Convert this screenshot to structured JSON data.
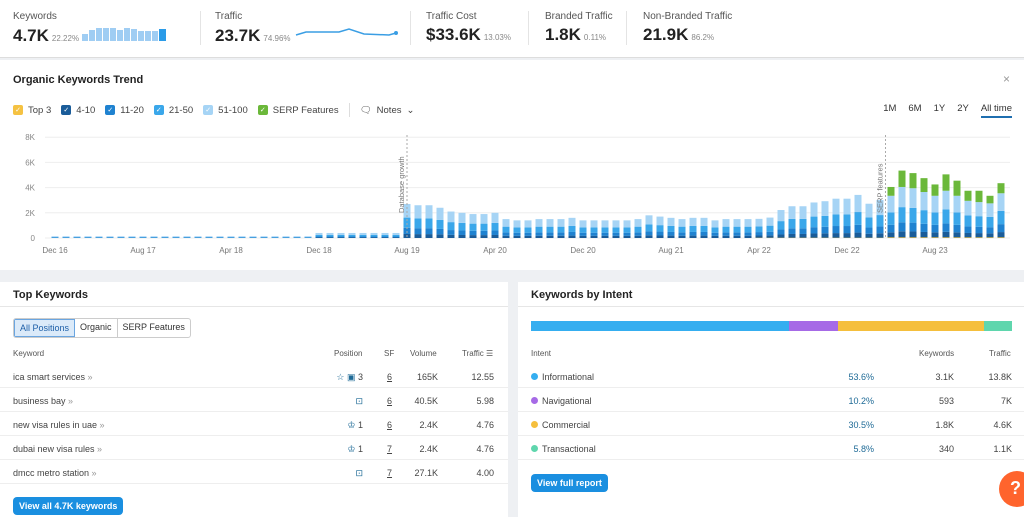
{
  "metrics": [
    {
      "label": "Keywords",
      "value": "4.7K",
      "pct": "22.22%"
    },
    {
      "label": "Traffic",
      "value": "23.7K",
      "pct": "74.96%"
    },
    {
      "label": "Traffic Cost",
      "value": "$33.6K",
      "pct": "13.03%"
    },
    {
      "label": "Branded Traffic",
      "value": "1.8K",
      "pct": "0.11%"
    },
    {
      "label": "Non-Branded Traffic",
      "value": "21.9K",
      "pct": "86.2%"
    }
  ],
  "trend": {
    "title": "Organic Keywords Trend",
    "close_icon": "×",
    "legend": [
      {
        "label": "Top 3",
        "color": "#f5c242"
      },
      {
        "label": "4-10",
        "color": "#1a5c99"
      },
      {
        "label": "11-20",
        "color": "#1f82d0"
      },
      {
        "label": "21-50",
        "color": "#3aa7ea"
      },
      {
        "label": "51-100",
        "color": "#a6d4f5"
      },
      {
        "label": "SERP Features",
        "color": "#6bb83a"
      }
    ],
    "notes_label": "Notes",
    "periods": [
      "1M",
      "6M",
      "1Y",
      "2Y",
      "All time"
    ],
    "active_period": "All time"
  },
  "chart_data": {
    "type": "bar",
    "stacked": true,
    "ylim": [
      0,
      8
    ],
    "y_ticks": [
      {
        "v": 0,
        "label": "0"
      },
      {
        "v": 2,
        "label": "2K"
      },
      {
        "v": 4,
        "label": "4K"
      },
      {
        "v": 6,
        "label": "6K"
      },
      {
        "v": 8,
        "label": "8K"
      }
    ],
    "x_ticks": [
      "Dec 16",
      "Aug 17",
      "Apr 18",
      "Dec 18",
      "Aug 19",
      "Apr 20",
      "Dec 20",
      "Aug 21",
      "Apr 22",
      "Dec 22",
      "Aug 23"
    ],
    "grid": true,
    "annotations": [
      {
        "label": "Database growth",
        "at": "Aug 19"
      },
      {
        "label": "SERP features",
        "at": "Apr 23"
      }
    ],
    "series": [
      {
        "name": "Top 3",
        "color": "#f5c242",
        "values": [
          0,
          0,
          0,
          0,
          0,
          0,
          0,
          0,
          0,
          0,
          0,
          0,
          0,
          0,
          0,
          0,
          0,
          0,
          0,
          0,
          0,
          0,
          0,
          0,
          0,
          0,
          0,
          0,
          0,
          0,
          0,
          0,
          0,
          0,
          0,
          0,
          0,
          0,
          0,
          0,
          0,
          0,
          0,
          0,
          0,
          0,
          0,
          0,
          0,
          0,
          0,
          0,
          0,
          0,
          0,
          0,
          0,
          0,
          0,
          0,
          0,
          0,
          0,
          0,
          0.02,
          0.02,
          0.02,
          0.02,
          0.02,
          0.02,
          0.02,
          0.02,
          0.02,
          0.02,
          0.02,
          0.02,
          0.05,
          0.05,
          0.05,
          0.05,
          0.05,
          0.05,
          0.05,
          0.05,
          0.05,
          0.05,
          0.05
        ]
      },
      {
        "name": "4-10",
        "color": "#1a5c99",
        "values": [
          0.01,
          0.01,
          0.01,
          0.01,
          0.01,
          0.01,
          0.01,
          0.01,
          0.01,
          0.01,
          0.01,
          0.01,
          0.01,
          0.01,
          0.01,
          0.01,
          0.01,
          0.01,
          0.01,
          0.01,
          0.01,
          0.01,
          0.01,
          0.01,
          0.05,
          0.05,
          0.05,
          0.05,
          0.05,
          0.05,
          0.05,
          0.05,
          0.32,
          0.31,
          0.31,
          0.29,
          0.25,
          0.24,
          0.23,
          0.23,
          0.24,
          0.18,
          0.17,
          0.17,
          0.18,
          0.18,
          0.18,
          0.19,
          0.17,
          0.17,
          0.17,
          0.17,
          0.17,
          0.18,
          0.22,
          0.2,
          0.19,
          0.18,
          0.19,
          0.19,
          0.17,
          0.18,
          0.18,
          0.18,
          0.18,
          0.19,
          0.26,
          0.3,
          0.3,
          0.34,
          0.35,
          0.37,
          0.37,
          0.41,
          0.32,
          0.36,
          0.4,
          0.48,
          0.47,
          0.43,
          0.4,
          0.44,
          0.4,
          0.35,
          0.34,
          0.32,
          0.42
        ]
      },
      {
        "name": "11-20",
        "color": "#1f82d0",
        "values": [
          0.02,
          0.02,
          0.02,
          0.02,
          0.02,
          0.02,
          0.02,
          0.02,
          0.02,
          0.02,
          0.02,
          0.02,
          0.02,
          0.02,
          0.02,
          0.02,
          0.02,
          0.02,
          0.02,
          0.02,
          0.02,
          0.02,
          0.02,
          0.02,
          0.07,
          0.07,
          0.07,
          0.07,
          0.07,
          0.07,
          0.07,
          0.07,
          0.49,
          0.47,
          0.47,
          0.43,
          0.38,
          0.36,
          0.34,
          0.34,
          0.36,
          0.27,
          0.25,
          0.25,
          0.27,
          0.27,
          0.27,
          0.29,
          0.25,
          0.25,
          0.25,
          0.25,
          0.25,
          0.27,
          0.32,
          0.31,
          0.29,
          0.27,
          0.29,
          0.29,
          0.25,
          0.27,
          0.27,
          0.27,
          0.27,
          0.29,
          0.4,
          0.45,
          0.45,
          0.5,
          0.52,
          0.56,
          0.56,
          0.61,
          0.49,
          0.54,
          0.59,
          0.72,
          0.7,
          0.65,
          0.59,
          0.67,
          0.59,
          0.52,
          0.5,
          0.49,
          0.63
        ]
      },
      {
        "name": "21-50",
        "color": "#3aa7ea",
        "values": [
          0.03,
          0.03,
          0.03,
          0.03,
          0.03,
          0.03,
          0.03,
          0.03,
          0.03,
          0.03,
          0.03,
          0.03,
          0.03,
          0.03,
          0.03,
          0.03,
          0.03,
          0.03,
          0.03,
          0.03,
          0.03,
          0.03,
          0.03,
          0.03,
          0.12,
          0.12,
          0.12,
          0.12,
          0.12,
          0.12,
          0.12,
          0.12,
          0.81,
          0.78,
          0.78,
          0.72,
          0.63,
          0.6,
          0.57,
          0.57,
          0.6,
          0.45,
          0.42,
          0.42,
          0.45,
          0.45,
          0.45,
          0.48,
          0.42,
          0.42,
          0.42,
          0.42,
          0.42,
          0.45,
          0.54,
          0.51,
          0.48,
          0.45,
          0.48,
          0.48,
          0.42,
          0.45,
          0.45,
          0.45,
          0.45,
          0.48,
          0.66,
          0.75,
          0.75,
          0.84,
          0.87,
          0.93,
          0.93,
          1.02,
          0.81,
          0.9,
          0.99,
          1.2,
          1.17,
          1.08,
          0.99,
          1.11,
          0.99,
          0.87,
          0.84,
          0.81,
          1.05
        ]
      },
      {
        "name": "51-100",
        "color": "#a6d4f5",
        "values": [
          0.04,
          0.04,
          0.04,
          0.04,
          0.04,
          0.04,
          0.04,
          0.04,
          0.04,
          0.04,
          0.04,
          0.04,
          0.04,
          0.04,
          0.04,
          0.04,
          0.04,
          0.04,
          0.04,
          0.04,
          0.04,
          0.04,
          0.04,
          0.04,
          0.16,
          0.16,
          0.16,
          0.16,
          0.16,
          0.16,
          0.16,
          0.16,
          1.08,
          1.04,
          1.04,
          0.96,
          0.84,
          0.8,
          0.76,
          0.76,
          0.8,
          0.6,
          0.56,
          0.56,
          0.6,
          0.6,
          0.6,
          0.64,
          0.56,
          0.56,
          0.56,
          0.56,
          0.56,
          0.6,
          0.72,
          0.68,
          0.64,
          0.6,
          0.64,
          0.64,
          0.56,
          0.6,
          0.6,
          0.6,
          0.6,
          0.64,
          0.88,
          1.0,
          1.0,
          1.12,
          1.16,
          1.24,
          1.24,
          1.36,
          1.08,
          1.2,
          1.32,
          1.6,
          1.56,
          1.44,
          1.32,
          1.48,
          1.32,
          1.16,
          1.12,
          1.08,
          1.4
        ]
      },
      {
        "name": "SERP Features",
        "color": "#6bb83a",
        "values": [
          0,
          0,
          0,
          0,
          0,
          0,
          0,
          0,
          0,
          0,
          0,
          0,
          0,
          0,
          0,
          0,
          0,
          0,
          0,
          0,
          0,
          0,
          0,
          0,
          0,
          0,
          0,
          0,
          0,
          0,
          0,
          0,
          0,
          0,
          0,
          0,
          0,
          0,
          0,
          0,
          0,
          0,
          0,
          0,
          0,
          0,
          0,
          0,
          0,
          0,
          0,
          0,
          0,
          0,
          0,
          0,
          0,
          0,
          0,
          0,
          0,
          0,
          0,
          0,
          0,
          0,
          0,
          0,
          0,
          0,
          0,
          0,
          0,
          0,
          0,
          0,
          0.7,
          1.3,
          1.2,
          1.1,
          0.9,
          1.3,
          1.2,
          0.8,
          0.9,
          0.6,
          0.8
        ]
      }
    ]
  },
  "top_keywords": {
    "title": "Top Keywords",
    "tabs": [
      "All Positions",
      "Organic",
      "SERP Features"
    ],
    "active_tab": "All Positions",
    "columns": [
      "Keyword",
      "Position",
      "SF",
      "Volume",
      "Traffic"
    ],
    "rows": [
      {
        "keyword": "ica smart services",
        "icons": [
          "star-icon",
          "image-icon"
        ],
        "position": "3",
        "sf": "6",
        "volume": "165K",
        "traffic": "12.55"
      },
      {
        "keyword": "business bay",
        "icons": [
          "review-icon"
        ],
        "position": "",
        "sf": "6",
        "volume": "40.5K",
        "traffic": "5.98"
      },
      {
        "keyword": "new visa rules in uae",
        "icons": [
          "crown-icon"
        ],
        "position": "1",
        "sf": "6",
        "volume": "2.4K",
        "traffic": "4.76"
      },
      {
        "keyword": "dubai new visa rules",
        "icons": [
          "crown-icon"
        ],
        "position": "1",
        "sf": "7",
        "volume": "2.4K",
        "traffic": "4.76"
      },
      {
        "keyword": "dmcc metro station",
        "icons": [
          "review-icon"
        ],
        "position": "",
        "sf": "7",
        "volume": "27.1K",
        "traffic": "4.00"
      }
    ],
    "view_all": "View all 4.7K keywords"
  },
  "intent": {
    "title": "Keywords by Intent",
    "columns": [
      "Intent",
      "Keywords",
      "Traffic"
    ],
    "rows": [
      {
        "label": "Informational",
        "pct": "53.6%",
        "share": 53.6,
        "keywords": "3.1K",
        "traffic": "13.8K",
        "color": "#35aef0"
      },
      {
        "label": "Navigational",
        "pct": "10.2%",
        "share": 10.2,
        "keywords": "593",
        "traffic": "7K",
        "color": "#a66ae6"
      },
      {
        "label": "Commercial",
        "pct": "30.5%",
        "share": 30.5,
        "keywords": "1.8K",
        "traffic": "4.6K",
        "color": "#f5bf3d"
      },
      {
        "label": "Transactional",
        "pct": "5.8%",
        "share": 5.8,
        "keywords": "340",
        "traffic": "1.1K",
        "color": "#5fd6ad"
      }
    ],
    "view_full": "View full report"
  },
  "help_label": "?"
}
